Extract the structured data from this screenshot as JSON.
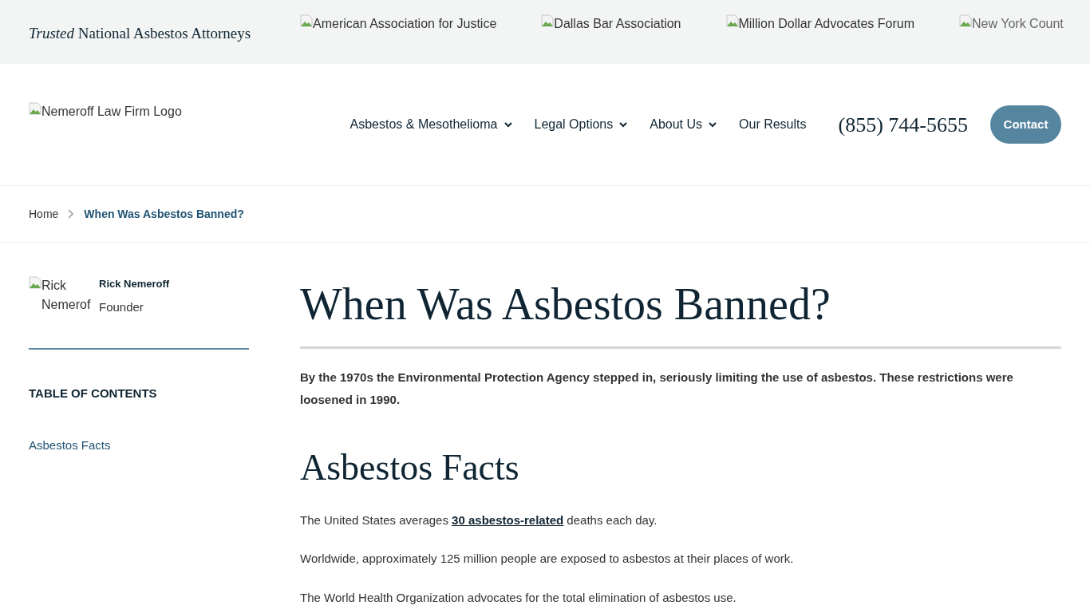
{
  "top_bar": {
    "tagline_emphasis": "Trusted",
    "tagline": "National Asbestos Attorneys",
    "badges": [
      "American Association for Justice",
      "Dallas Bar Association",
      "Million Dollar Advocates Forum",
      "New York Count"
    ]
  },
  "header": {
    "logo_alt": "Nemeroff Law Firm Logo",
    "nav": [
      {
        "label": "Asbestos & Mesothelioma",
        "has_dropdown": true
      },
      {
        "label": "Legal Options",
        "has_dropdown": true
      },
      {
        "label": "About Us",
        "has_dropdown": true
      },
      {
        "label": "Our Results",
        "has_dropdown": false
      }
    ],
    "phone": "(855) 744-5655",
    "contact_button": "Contact"
  },
  "breadcrumb": [
    {
      "label": "Home",
      "current": false
    },
    {
      "label": "When Was Asbestos Banned?",
      "current": true
    }
  ],
  "sidebar": {
    "author": {
      "photo_alt": "Rick Nemerof",
      "name": "Rick Nemeroff",
      "role": "Founder"
    },
    "toc_title": "TABLE OF CONTENTS",
    "toc_items": [
      "Asbestos Facts"
    ]
  },
  "article": {
    "title": "When Was Asbestos Banned?",
    "intro": "By the 1970s the Environmental Protection Agency stepped in, seriously limiting the use of asbestos. These restrictions were loosened in 1990.",
    "sections": [
      {
        "heading": "Asbestos Facts",
        "paragraphs": [
          [
            {
              "kind": "text",
              "text": "The United States averages "
            },
            {
              "kind": "link",
              "text": "30 asbestos-related"
            },
            {
              "kind": "text",
              "text": " deaths each day."
            }
          ],
          [
            {
              "kind": "text",
              "text": "Worldwide, approximately 125 million people are exposed to asbestos at their places of work."
            }
          ],
          [
            {
              "kind": "text",
              "text": "The World Health Organization advocates for the total elimination of asbestos use."
            }
          ]
        ]
      }
    ]
  }
}
